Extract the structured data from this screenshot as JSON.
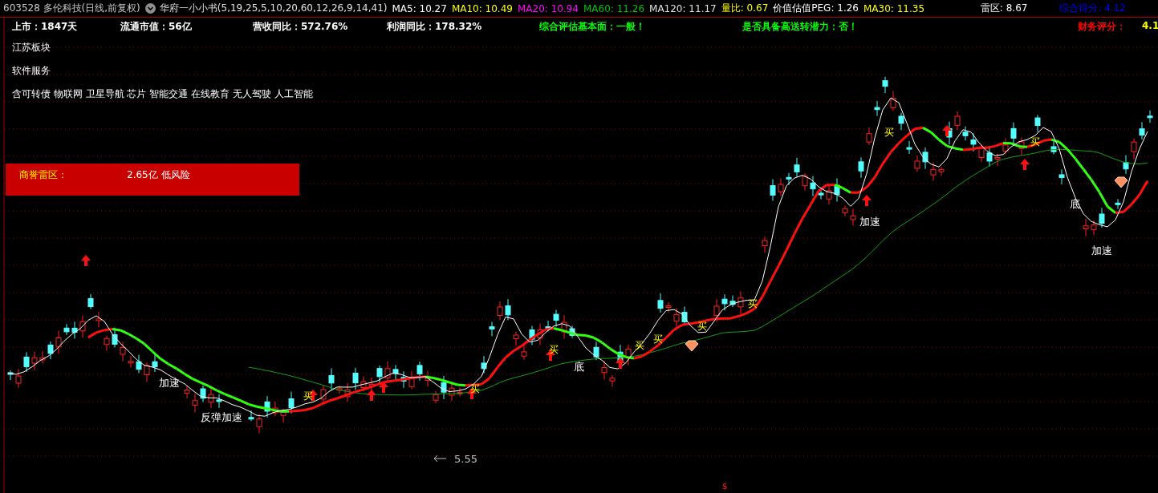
{
  "quote_bar": [
    {
      "kind": "title",
      "text": "603528 多伦科技(日线,前复权)",
      "color": "#c8c8c8"
    },
    {
      "kind": "menu",
      "text": "华府一小小书(5,19,25,5,10,20,60,12,26,9,14,41)",
      "color": "#e0e0e0"
    },
    {
      "kind": "value",
      "text": "MA5: 10.27",
      "color": "#ffffff"
    },
    {
      "kind": "value",
      "text": "MA10: 10.49",
      "color": "#ffff00"
    },
    {
      "kind": "value",
      "text": "MA20: 10.94",
      "color": "#ff00ff"
    },
    {
      "kind": "value",
      "text": "MA60: 11.26",
      "color": "#00c000"
    },
    {
      "kind": "value",
      "text": "MA120: 11.17",
      "color": "#e0e0e0"
    },
    {
      "kind": "value",
      "text": "量比: 0.67",
      "color": "#ffff00"
    },
    {
      "kind": "value",
      "text": "价值估值PEG: 1.26",
      "color": "#ffffff"
    },
    {
      "kind": "value",
      "text": "MA30: 11.35",
      "color": "#ffff00"
    }
  ],
  "scores": [
    {
      "text": "雷区: 8.67",
      "color": "#ffffff"
    },
    {
      "text": "综合得分: 4.12",
      "color": "#0000ff"
    }
  ],
  "fundamentals": [
    {
      "text": "上市：1847天",
      "color": "#ffffff"
    },
    {
      "text": "流通市值：56亿",
      "color": "#ffffff"
    },
    {
      "text": "营收同比：572.76%",
      "color": "#ffffff"
    },
    {
      "text": "利润同比：178.32%",
      "color": "#ffffff"
    },
    {
      "text": "综合评估基本面：一般！",
      "color": "#00ff00"
    },
    {
      "text": "是否具备高送转潜力：否！",
      "color": "#00ff00"
    },
    {
      "text": "财务评分：",
      "color": "#ff0000"
    },
    {
      "text": "4.1",
      "color": "#ffff00"
    }
  ],
  "sectors": [
    "江苏板块",
    "软件服务",
    "含可转债 物联网 卫星导航 芯片 智能交通 在线教育 无人驾驶 人工智能"
  ],
  "goodwill": {
    "label": "商誉雷区：",
    "value": "2.65亿 低风险"
  },
  "chart": {
    "annotations": [
      {
        "kind": "signal",
        "text": "加速"
      },
      {
        "kind": "signal",
        "text": "反弹"
      },
      {
        "kind": "signal",
        "text": "加速"
      },
      {
        "kind": "buy",
        "text": "买"
      },
      {
        "kind": "buy",
        "text": "买"
      },
      {
        "kind": "buy",
        "text": "买"
      },
      {
        "kind": "signal",
        "text": "底"
      },
      {
        "kind": "buy",
        "text": "买"
      },
      {
        "kind": "buy",
        "text": "买"
      },
      {
        "kind": "buy",
        "text": "买"
      },
      {
        "kind": "buy",
        "text": "买"
      },
      {
        "kind": "signal",
        "text": "加速"
      },
      {
        "kind": "buy",
        "text": "买"
      },
      {
        "kind": "buy",
        "text": "买"
      },
      {
        "kind": "signal",
        "text": "底"
      },
      {
        "kind": "signal",
        "text": "加速"
      },
      {
        "kind": "low",
        "text": "5.55"
      },
      {
        "kind": "marker",
        "text": "$"
      }
    ]
  }
}
